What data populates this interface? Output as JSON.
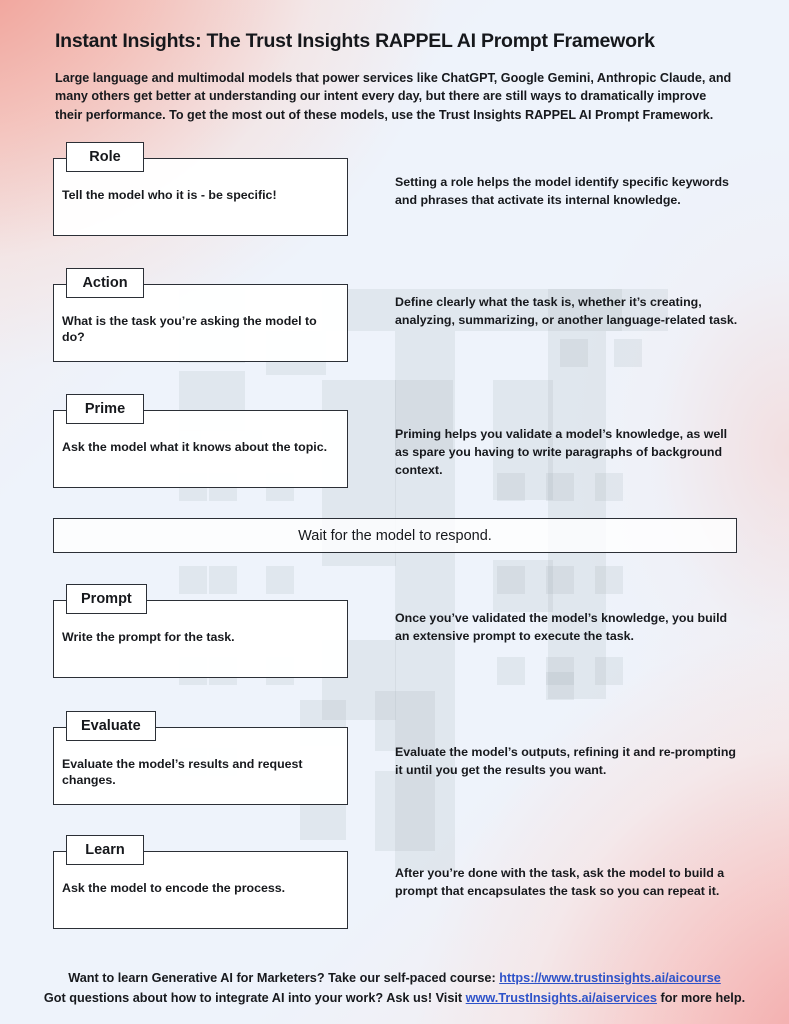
{
  "page": {
    "title": "Instant Insights: The Trust Insights RAPPEL AI Prompt Framework",
    "intro": "Large language and multimodal models that power services like ChatGPT, Google Gemini, Anthropic Claude, and many others get better at understanding our intent every day, but there are still ways to dramatically improve their performance. To get the most out of these models, use the Trust Insights RAPPEL AI Prompt Framework.",
    "background_gradient_colors": [
      "#f09a8c",
      "#eef3fb",
      "#f3a0a0"
    ],
    "watermark": "trust-insights-ti-logo-blocks"
  },
  "steps": [
    {
      "label": "Role",
      "box_text": "Tell the model who it is - be specific!",
      "description": "Setting a role helps the model identify specific keywords and phrases that activate its internal knowledge."
    },
    {
      "label": "Action",
      "box_text": "What is the task you’re asking the model to do?",
      "description": "Define clearly what the task is, whether it’s creating, analyzing, summarizing, or another language-related task."
    },
    {
      "label": "Prime",
      "box_text": "Ask the model what it knows about the topic.",
      "description": "Priming helps you validate a model’s knowledge, as well as spare you having to write paragraphs of background context."
    },
    {
      "label": "Prompt",
      "box_text": "Write the prompt for the task.",
      "description": "Once you’ve validated the model’s knowledge, you build an extensive prompt to execute the task."
    },
    {
      "label": "Evaluate",
      "box_text": "Evaluate the model’s results and request changes.",
      "description": "Evaluate the model’s outputs, refining it and re-prompting it until you get the results you want."
    },
    {
      "label": "Learn",
      "box_text": "Ask the model to encode the process.",
      "description": "After you’re done with the task, ask the model to build a prompt that encapsulates the task so you can repeat it."
    }
  ],
  "wait_bar": {
    "text": "Wait for the model to respond."
  },
  "footer": {
    "line1_prefix": "Want to learn Generative AI for Marketers? Take our self-paced course: ",
    "line1_link": "https://www.trustinsights.ai/aicourse",
    "line2_prefix": "Got questions about how to integrate AI into your work? Ask us! Visit ",
    "line2_link": "www.TrustInsights.ai/aiservices",
    "line2_suffix": " for more help.",
    "link_color": "#2f53c9"
  }
}
